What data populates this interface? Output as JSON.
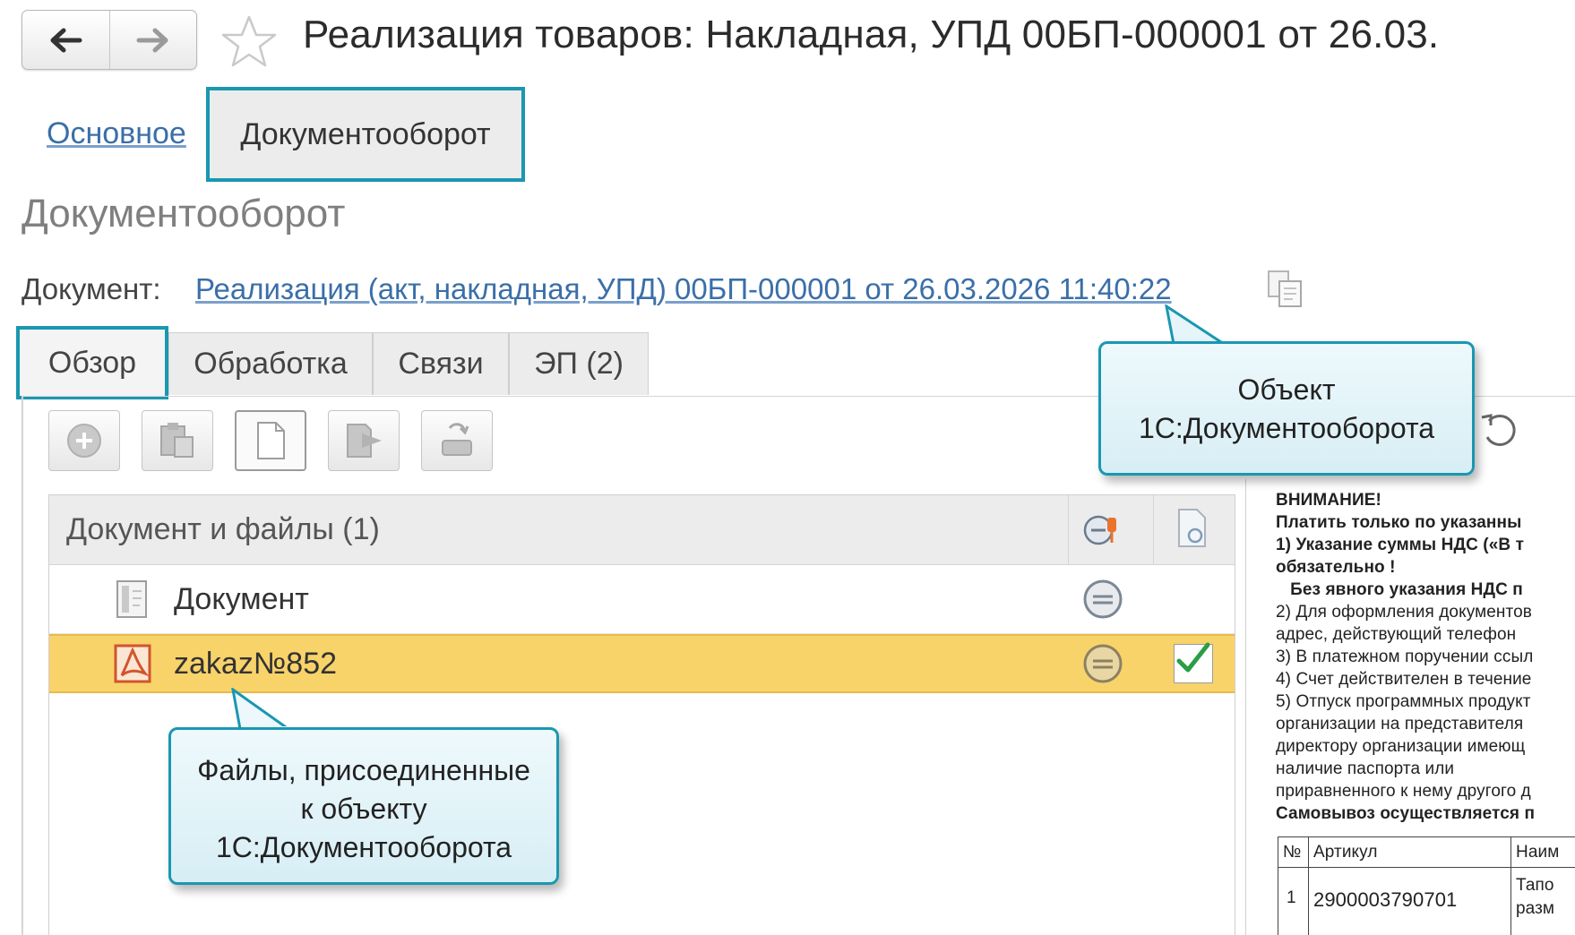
{
  "header": {
    "title": "Реализация товаров: Накладная, УПД 00БП-000001 от 26.03.",
    "back_icon": "arrow-left-icon",
    "forward_icon": "arrow-right-icon",
    "favorite_icon": "star-icon"
  },
  "section_tabs": {
    "main": "Основное",
    "docflow": "Документооборот"
  },
  "section_title": "Документооборот",
  "document": {
    "label": "Документ:",
    "link": "Реализация (акт, накладная, УПД) 00БП-000001 от 26.03.2026 11:40:22",
    "copy_icon": "copy-icon"
  },
  "inner_tabs": [
    "Обзор",
    "Обработка",
    "Связи",
    "ЭП (2)"
  ],
  "toolbar": {
    "icons": [
      "add-icon",
      "paste-icon",
      "new-document-icon",
      "send-icon",
      "scanner-icon"
    ],
    "undo_icon": "undo-icon"
  },
  "list": {
    "header": "Документ и файлы (1)",
    "header_icons": [
      "signature-key-icon",
      "file-preview-icon"
    ],
    "rows": [
      {
        "name": "Документ",
        "icon": "document-icon",
        "status_icon": "status-circle-icon",
        "checked": false
      },
      {
        "name": "zakaz№852",
        "icon": "pdf-icon",
        "status_icon": "status-circle-icon",
        "checked": true
      }
    ]
  },
  "preview": {
    "lines": [
      "ВНИМАНИЕ!",
      "Платить только по указанны",
      "1) Указание суммы НДС («В т",
      "обязательно !",
      "   Без явного указания НДС п",
      "2) Для оформления документов",
      "адрес, действующий телефон",
      "3) В платежном поручении ссыл",
      "4) Счет действителен в течение",
      "5) Отпуск программных продукт",
      "организации на представителя",
      "директору организации имеющ",
      "наличие паспорта или",
      "приравненного к нему другого д",
      "Самовывоз осуществляется п"
    ],
    "table": {
      "headers": [
        "№",
        "Артикул",
        "Наим"
      ],
      "row": [
        "1",
        "2900003790701",
        "Тапо",
        "разм"
      ]
    }
  },
  "callouts": {
    "object": "Объект\n1С:Документооборота",
    "files": "Файлы, присоединенные\nк объекту\n1С:Документооборота"
  },
  "colors": {
    "accent": "#1a97b1",
    "link": "#3a6fa8",
    "selected_row": "#f8d36a",
    "callout_bg": "#e3f4f9"
  }
}
